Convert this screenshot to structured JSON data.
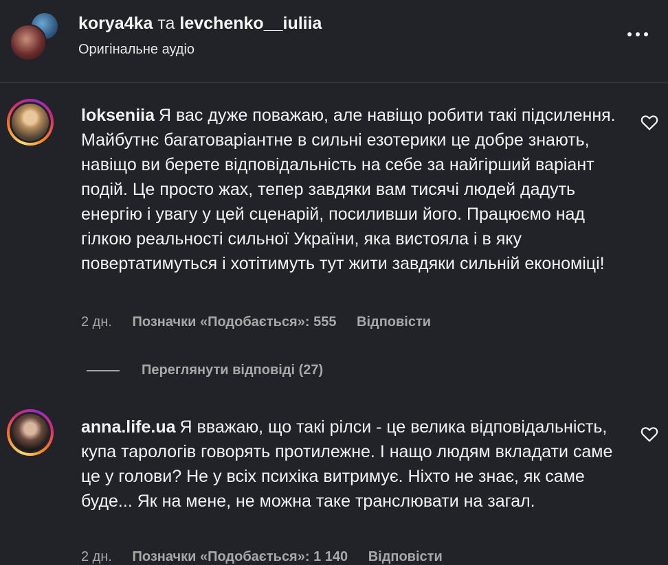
{
  "header": {
    "user1": "korya4ka",
    "connector": "та",
    "user2": "levchenko__iuliia",
    "subtitle": "Оригінальне аудіо"
  },
  "comments": [
    {
      "username": "lokseniia",
      "text": "Я вас дуже поважаю, але навіщо робити такі підсилення. Майбутнє багатоваріантне в сильні езотерики це добре знають, навіщо ви берете відповідальність на себе за найгірший варіант подій. Це просто жах, тепер завдяки вам тисячі людей дадуть енергію і увагу у цей сценарій, посиливши його. Працюємо над гілкою реальності сильної України, яка вистояла і в яку повертатимуться і хотітимуть тут жити завдяки сильній економіці!",
      "time": "2 дн.",
      "likes": "Позначки «Подобається»: 555",
      "reply": "Відповісти",
      "view_replies": "Переглянути відповіді (27)"
    },
    {
      "username": "anna.life.ua",
      "text": "Я вважаю, що такі рілси - це велика відповідальність, купа тарологів говорять протилежне. І нащо людям вкладати саме це у голови? Не у всіх психіка витримує. Ніхто не знає, як саме буде... Як на мене, не можна таке транслювати на загал.",
      "time": "2 дн.",
      "likes": "Позначки «Подобається»: 1 140",
      "reply": "Відповісти"
    }
  ],
  "icons": {
    "more": "more-horizontal-icon",
    "like": "heart-outline-icon"
  }
}
